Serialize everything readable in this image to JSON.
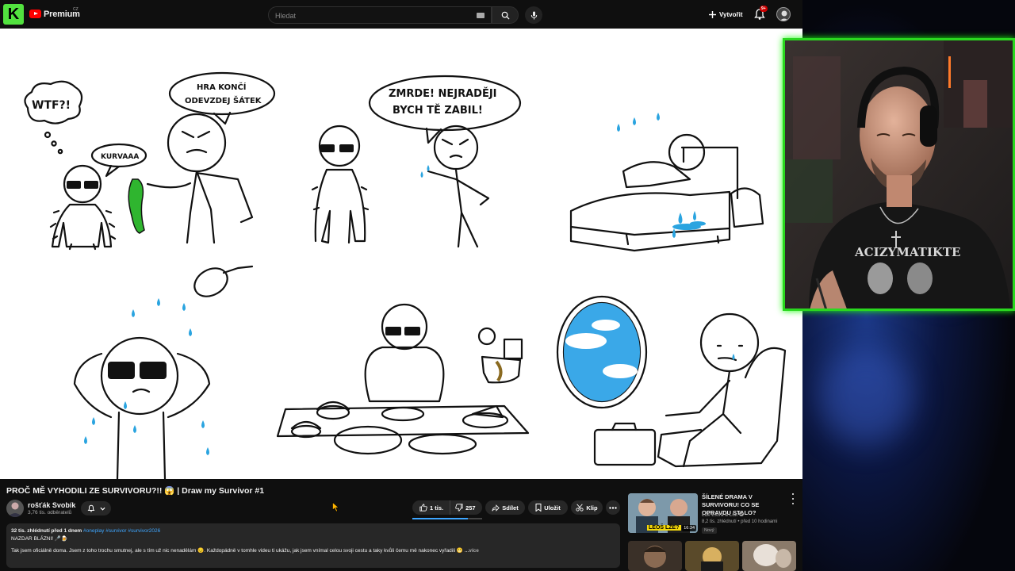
{
  "topbar": {
    "kick_logo": "K",
    "brand": "Premium",
    "brand_region": "CZ",
    "search_placeholder": "Hledat",
    "create_label": "Vytvořit",
    "notification_count": "9+"
  },
  "comic": {
    "bubble_wtf": "WTF?!",
    "bubble_kurvaaa": "KURVAAA",
    "bubble_hra_line1": "HRA KONČÍ",
    "bubble_hra_line2": "ODEVZDEJ ŠÁTEK",
    "bubble_zmrde_line1": "ZMRDE! NEJRADĚJI",
    "bubble_zmrde_line2": "BYCH TĚ ZABIL!"
  },
  "video": {
    "title": "PROČ MĚ VYHODILI ZE SURVIVORU?!! 😱 | Draw my Survivor #1",
    "channel_name": "rošťák Svobík",
    "channel_subs": "3,76 tis. odběratelů",
    "likes": "1 tis.",
    "dislikes": "257",
    "like_ratio": 0.8,
    "share_label": "Sdílet",
    "save_label": "Uložit",
    "clip_label": "Klip"
  },
  "description": {
    "meta": "32 tis. zhlédnutí  před 1 dnem",
    "tags": "#oneplay #survivor #survivor2026",
    "line2": "NAZDAR BLÁZNI! 🎤🍺",
    "line3": "Tak jsem oficiálně doma. Jsem z toho trochu smutnej, ale s tím už nic nenadělám 😔. Každopádně v tomhle videu ti ukážu, jak jsem vnímal celou svoji cestu a taky kvůli čemu mě nakonec vyřadili 😬",
    "more": "...více"
  },
  "recommended": {
    "title": "ŠÍLENÉ DRAMA V SURVIVORU! CO SE OPRAVDU STALO?",
    "channel": "Lůk Extra a Lůk",
    "meta": "8,2 tis. zhlédnutí • před 10 hodinami",
    "badge": "Nový",
    "duration": "16:34",
    "thumb_label": "LEOŠ LŽE?"
  }
}
